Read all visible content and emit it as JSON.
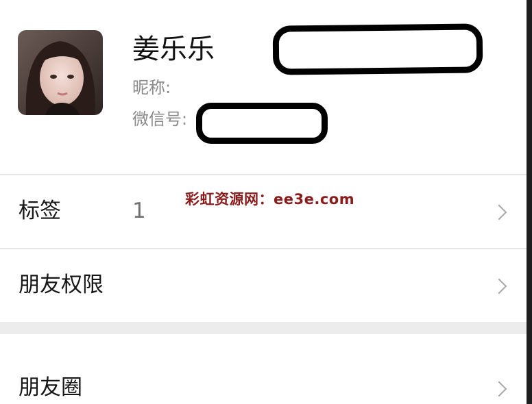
{
  "profile": {
    "name": "姜乐乐",
    "nickname_label": "昵称:",
    "wechat_id_label": "微信号:"
  },
  "watermark": "彩虹资源网：ee3e.com",
  "menu": {
    "tags": {
      "label": "标签",
      "value": "1"
    },
    "friend_permissions": {
      "label": "朋友权限"
    },
    "moments": {
      "label": "朋友圈"
    }
  },
  "colors": {
    "accent_watermark": "#8b1c1c",
    "divider": "#e6e6e6",
    "section_gap": "#ececec"
  },
  "icons": {
    "chevron": "chevron-right-icon"
  }
}
